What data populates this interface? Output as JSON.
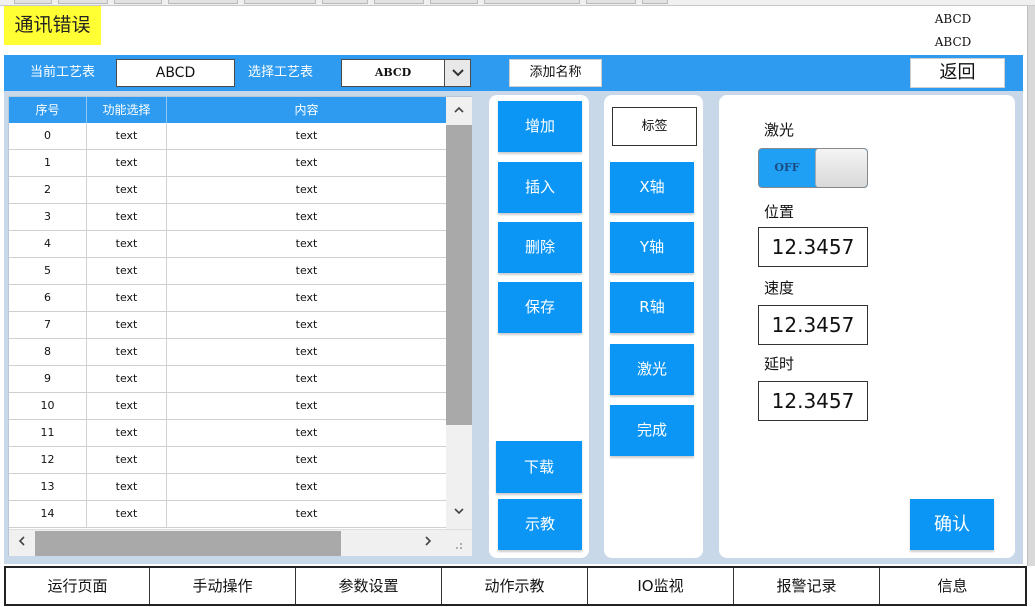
{
  "error_badge": "通讯错误",
  "corner_top": "ABCD",
  "corner_bottom": "ABCD",
  "toolbar": {
    "current_label": "当前工艺表",
    "current_value": "ABCD",
    "select_label": "选择工艺表",
    "select_value": "ABCD",
    "add_name_button": "添加名称",
    "back_button": "返回"
  },
  "table": {
    "headers": [
      "序号",
      "功能选择",
      "内容"
    ],
    "rows": [
      [
        "0",
        "text",
        "text"
      ],
      [
        "1",
        "text",
        "text"
      ],
      [
        "2",
        "text",
        "text"
      ],
      [
        "3",
        "text",
        "text"
      ],
      [
        "4",
        "text",
        "text"
      ],
      [
        "5",
        "text",
        "text"
      ],
      [
        "6",
        "text",
        "text"
      ],
      [
        "7",
        "text",
        "text"
      ],
      [
        "8",
        "text",
        "text"
      ],
      [
        "9",
        "text",
        "text"
      ],
      [
        "10",
        "text",
        "text"
      ],
      [
        "11",
        "text",
        "text"
      ],
      [
        "12",
        "text",
        "text"
      ],
      [
        "13",
        "text",
        "text"
      ],
      [
        "14",
        "text",
        "text"
      ]
    ]
  },
  "edit_buttons": {
    "add": "增加",
    "insert": "插入",
    "delete": "删除",
    "save": "保存",
    "download": "下载",
    "teach": "示教"
  },
  "axis_panel": {
    "tag": "标签",
    "x_axis": "X轴",
    "y_axis": "Y轴",
    "r_axis": "R轴",
    "laser": "激光",
    "done": "完成"
  },
  "params": {
    "laser_label": "激光",
    "laser_toggle": "OFF",
    "position_label": "位置",
    "position_value": "12.3457",
    "speed_label": "速度",
    "speed_value": "12.3457",
    "delay_label": "延时",
    "delay_value": "12.3457",
    "confirm_button": "确认"
  },
  "nav": [
    "运行页面",
    "手动操作",
    "参数设置",
    "动作示教",
    "IO监视",
    "报警记录",
    "信息"
  ],
  "colors": {
    "accent_blue": "#2e9bf0",
    "button_blue": "#0b96f5",
    "error_yellow": "#ffff33",
    "panel_bg": "#c9d8e8"
  }
}
